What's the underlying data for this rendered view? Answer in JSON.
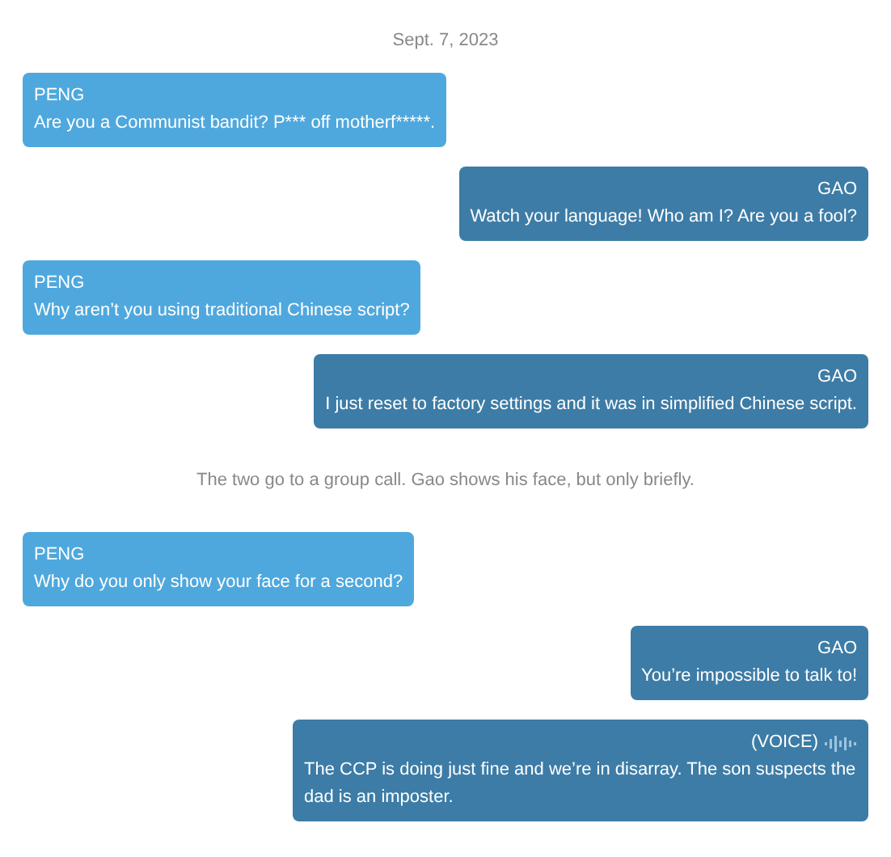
{
  "date": "Sept. 7, 2023",
  "items": [
    {
      "kind": "message",
      "outgoing": false,
      "sender": "PENG",
      "text": "Are you a Communist bandit? P*** off motherf*****."
    },
    {
      "kind": "message",
      "outgoing": true,
      "sender": "GAO",
      "text": "Watch your language! Who am I? Are you a fool?"
    },
    {
      "kind": "message",
      "outgoing": false,
      "sender": "PENG",
      "text": "Why aren’t you using traditional Chinese script?"
    },
    {
      "kind": "message",
      "outgoing": true,
      "sender": "GAO",
      "text": "I just reset to factory settings and it was in simplified Chinese script."
    },
    {
      "kind": "note",
      "text": "The two go to a group call. Gao shows his face, but only briefly."
    },
    {
      "kind": "message",
      "outgoing": false,
      "sender": "PENG",
      "text": "Why do you only show your face for a second?"
    },
    {
      "kind": "message",
      "outgoing": true,
      "sender": "GAO",
      "text": "You’re impossible to talk to!"
    },
    {
      "kind": "message",
      "outgoing": true,
      "sender": "(VOICE)",
      "voice": true,
      "text": "The CCP is doing just fine and we’re in disarray. The son suspects the dad is an imposter."
    }
  ]
}
